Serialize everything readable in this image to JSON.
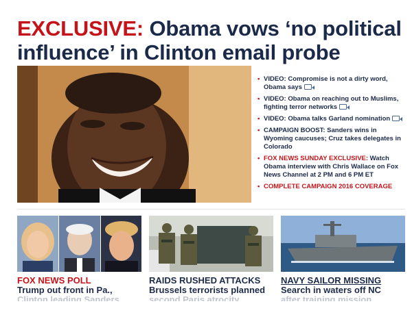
{
  "lead": {
    "kicker": "EXCLUSIVE:",
    "title": "Obama vows ‘no political influence’ in Clinton email probe"
  },
  "bullets": [
    {
      "text": "VIDEO: Compromise is not a dirty word, Obama says",
      "icon": "video-camera-icon"
    },
    {
      "text": "VIDEO: Obama on reaching out to Muslims, fighting terror networks",
      "icon": "video-camera-icon"
    },
    {
      "text": "VIDEO: Obama talks Garland nomination",
      "icon": "video-camera-icon"
    },
    {
      "text": "CAMPAIGN BOOST: Sanders wins in Wyoming caucuses; Cruz takes delegates in Colorado"
    },
    {
      "kicker": "FOX NEWS SUNDAY EXCLUSIVE:",
      "text": "Watch Obama interview with Chris Wallace on Fox News Channel at 2 PM and 6 PM ET"
    },
    {
      "text": "COMPLETE CAMPAIGN 2016 COVERAGE",
      "style": "red"
    }
  ],
  "tiles": [
    {
      "kicker": "FOX NEWS POLL",
      "line1": "Trump out front in Pa.,",
      "line2": "Clinton leading Sanders"
    },
    {
      "kicker": "RAIDS RUSHED ATTACKS",
      "line1": "Brussels terrorists planned",
      "line2": "second Paris atrocity"
    },
    {
      "kicker": "NAVY SAILOR MISSING",
      "line1": "Search in waters off NC",
      "line2": "after training mission"
    }
  ],
  "colors": {
    "accent_red": "#c5131a",
    "navy": "#1c2a4a",
    "link_blue": "#4b6b96"
  }
}
